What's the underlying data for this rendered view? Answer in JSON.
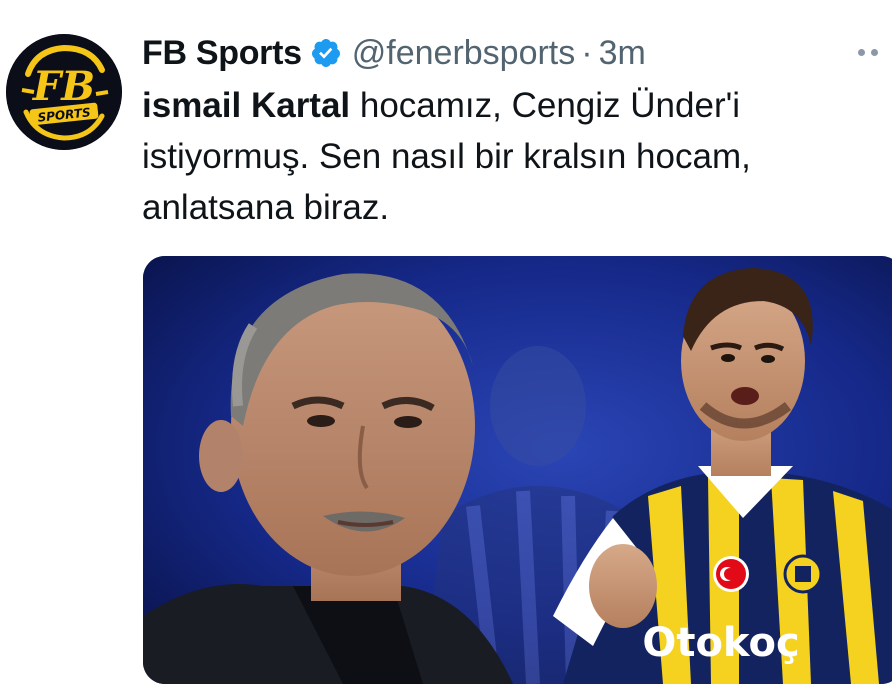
{
  "tweet": {
    "display_name": "FB Sports",
    "handle": "@fenerbsports",
    "separator": "·",
    "time": "3m",
    "mention": "ismail Kartal",
    "text_rest": " hocamız, Cengiz Ünder'i istiyormuş. Sen nasıl bir kralsın hocam, anlatsana biraz."
  },
  "avatar": {
    "logo_text": "FB",
    "logo_subtext": "SPORTS",
    "logo_color": "#f5c518"
  },
  "media": {
    "jersey_sponsor": "Otokoç",
    "colors": {
      "navy": "#13235f",
      "yellow": "#f4d21f",
      "background": "#1b2f8a"
    }
  },
  "icons": {
    "verified": "verified-badge-icon",
    "more": "more-options-icon"
  },
  "colors": {
    "text": "#0f1419",
    "secondary": "#536471",
    "verified_blue": "#1d9bf0"
  }
}
